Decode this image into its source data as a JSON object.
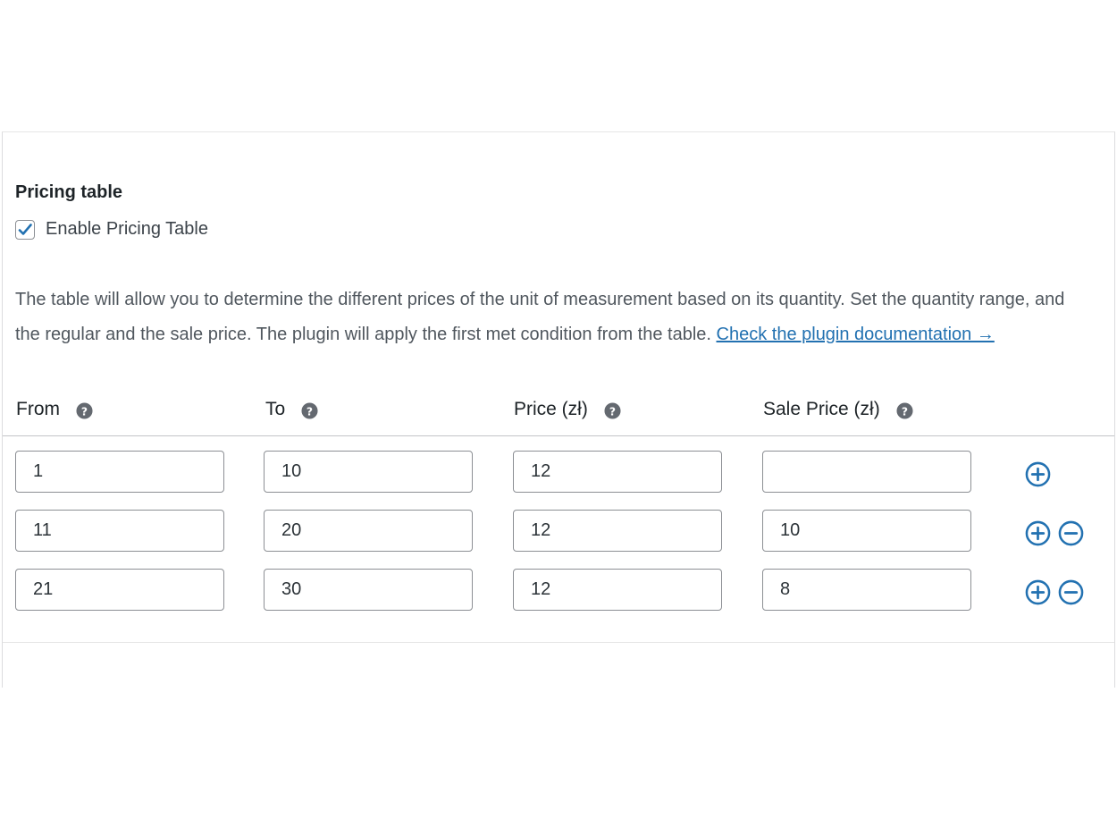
{
  "section": {
    "title": "Pricing table",
    "enable_label": "Enable Pricing Table",
    "enabled": true,
    "description": "The table will allow you to determine the different prices of the unit of measurement based on its quantity. Set the quantity range, and the regular and the sale price. The plugin will apply the first met condition from the table. ",
    "doc_link": "Check the plugin documentation →"
  },
  "table": {
    "headers": [
      "From",
      "To",
      "Price (zł)",
      "Sale Price (zł)"
    ],
    "rows": [
      {
        "from": "1",
        "to": "10",
        "price": "12",
        "sale": ""
      },
      {
        "from": "11",
        "to": "20",
        "price": "12",
        "sale": "10"
      },
      {
        "from": "21",
        "to": "30",
        "price": "12",
        "sale": "8"
      }
    ]
  },
  "icons": {
    "help": "help-circle-icon",
    "add": "plus-circle-icon",
    "remove": "minus-circle-icon"
  },
  "colors": {
    "accent": "#2271b1",
    "help_icon": "#646970",
    "border": "#8c8f94"
  }
}
